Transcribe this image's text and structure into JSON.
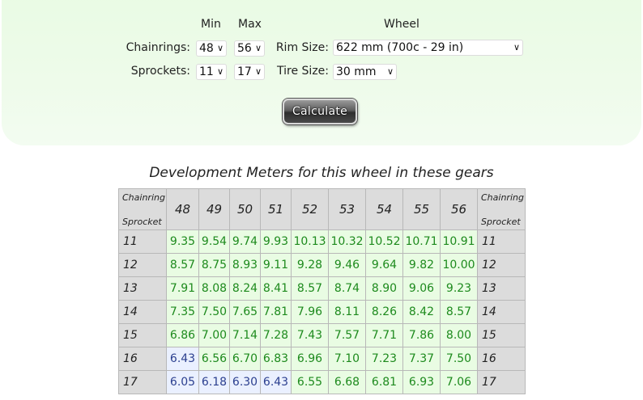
{
  "form": {
    "min_header": "Min",
    "max_header": "Max",
    "wheel_header": "Wheel",
    "chainrings_label": "Chainrings:",
    "sprockets_label": "Sprockets:",
    "rim_label": "Rim Size:",
    "tire_label": "Tire Size:",
    "chainring_min": "48",
    "chainring_max": "56",
    "sprocket_min": "11",
    "sprocket_max": "17",
    "rim_size": "622 mm (700c - 29 in)",
    "tire_size": "30 mm",
    "calculate_label": "Calculate"
  },
  "table": {
    "title": "Development Meters for this wheel in these gears",
    "corner_top": "Chainring",
    "corner_bottom": "Sprocket",
    "chainrings": [
      "48",
      "49",
      "50",
      "51",
      "52",
      "53",
      "54",
      "55",
      "56"
    ],
    "rows": [
      {
        "sprocket": "11",
        "values": [
          "9.35",
          "9.54",
          "9.74",
          "9.93",
          "10.13",
          "10.32",
          "10.52",
          "10.71",
          "10.91"
        ]
      },
      {
        "sprocket": "12",
        "values": [
          "8.57",
          "8.75",
          "8.93",
          "9.11",
          "9.28",
          "9.46",
          "9.64",
          "9.82",
          "10.00"
        ]
      },
      {
        "sprocket": "13",
        "values": [
          "7.91",
          "8.08",
          "8.24",
          "8.41",
          "8.57",
          "8.74",
          "8.90",
          "9.06",
          "9.23"
        ]
      },
      {
        "sprocket": "14",
        "values": [
          "7.35",
          "7.50",
          "7.65",
          "7.81",
          "7.96",
          "8.11",
          "8.26",
          "8.42",
          "8.57"
        ]
      },
      {
        "sprocket": "15",
        "values": [
          "6.86",
          "7.00",
          "7.14",
          "7.28",
          "7.43",
          "7.57",
          "7.71",
          "7.86",
          "8.00"
        ]
      },
      {
        "sprocket": "16",
        "values": [
          "6.43",
          "6.56",
          "6.70",
          "6.83",
          "6.96",
          "7.10",
          "7.23",
          "7.37",
          "7.50"
        ]
      },
      {
        "sprocket": "17",
        "values": [
          "6.05",
          "6.18",
          "6.30",
          "6.43",
          "6.55",
          "6.68",
          "6.81",
          "6.93",
          "7.06"
        ]
      }
    ],
    "colors": {
      "green_bg": "#e9fce3",
      "green_text": "#1d8a1d",
      "blue_bg": "#eaf0ff",
      "blue_text": "#2b3f8f"
    }
  }
}
